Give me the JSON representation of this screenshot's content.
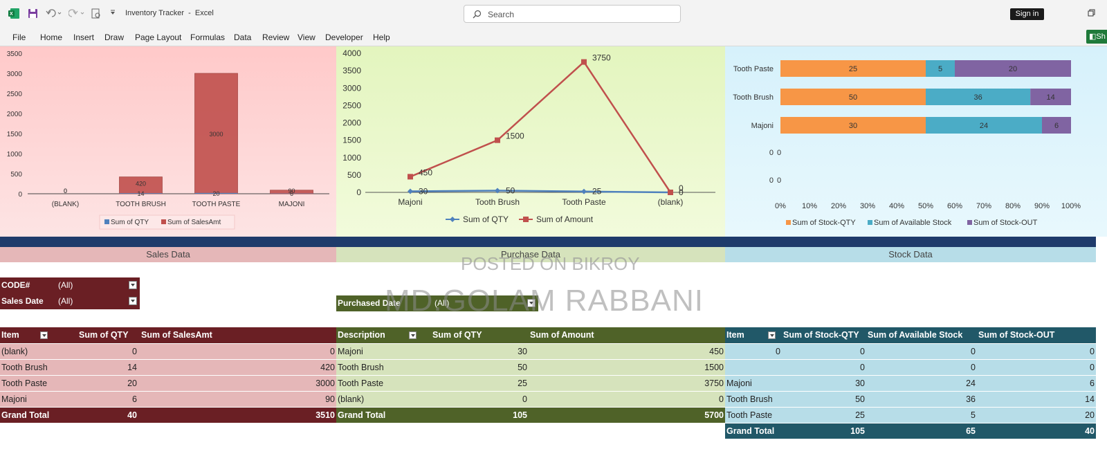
{
  "titlebar": {
    "doc": "Inventory Tracker",
    "sep": "-",
    "app": "Excel",
    "search_label": "Search",
    "signin": "Sign in"
  },
  "menu": [
    "File",
    "Home",
    "Insert",
    "Draw",
    "Page Layout",
    "Formulas",
    "Data",
    "Review",
    "View",
    "Developer",
    "Help"
  ],
  "share_label": "Sh",
  "sections": {
    "sales": "Sales Data",
    "purchase": "Purchase Data",
    "stock": "Stock Data"
  },
  "watermark": {
    "line1": "POSTED ON BIKROY",
    "line2": "MD.GOLAM RABBANI"
  },
  "colors": {
    "sales_dark": "#6a1f24",
    "sales_light": "#e5b7b8",
    "purchase_dark": "#4f6228",
    "purchase_light": "#d6e3bc",
    "stock_dark": "#215868",
    "stock_light": "#b7dde8",
    "bar_red": "#c0504d",
    "line_blue": "#4f81bd",
    "orange": "#f79646",
    "teal": "#4bacc6",
    "purple": "#8064a2"
  },
  "chart_data": [
    {
      "type": "bar",
      "categories": [
        "(BLANK)",
        "TOOTH BRUSH",
        "TOOTH PASTE",
        "MAJONI"
      ],
      "series": [
        {
          "name": "Sum of QTY",
          "values": [
            0,
            14,
            20,
            6
          ]
        },
        {
          "name": "Sum of SalesAmt",
          "values": [
            0,
            420,
            3000,
            90
          ]
        }
      ],
      "ylim": [
        0,
        3500
      ],
      "yticks": [
        "0",
        "500",
        "1000",
        "1500",
        "2000",
        "2500",
        "3000",
        "3500"
      ],
      "legend": "bottom"
    },
    {
      "type": "line",
      "categories": [
        "Majoni",
        "Tooth Brush",
        "Tooth Paste",
        "(blank)"
      ],
      "series": [
        {
          "name": "Sum of QTY",
          "values": [
            30,
            50,
            25,
            0
          ]
        },
        {
          "name": "Sum of Amount",
          "values": [
            450,
            1500,
            3750,
            0
          ]
        }
      ],
      "ylim": [
        0,
        4000
      ],
      "yticks": [
        "0",
        "500",
        "1000",
        "1500",
        "2000",
        "2500",
        "3000",
        "3500",
        "4000"
      ],
      "legend": "bottom"
    },
    {
      "type": "bar",
      "stacked": true,
      "orientation": "horizontal",
      "percent": true,
      "categories": [
        "Tooth Paste",
        "Tooth Brush",
        "Majoni"
      ],
      "series": [
        {
          "name": "Sum of Stock-QTY",
          "values": [
            25,
            50,
            30
          ]
        },
        {
          "name": "Sum of Available Stock",
          "values": [
            5,
            36,
            24
          ]
        },
        {
          "name": "Sum of Stock-OUT",
          "values": [
            20,
            14,
            6
          ]
        }
      ],
      "empty_rows": [
        "0",
        "0"
      ],
      "xticks": [
        "0%",
        "10%",
        "20%",
        "30%",
        "40%",
        "50%",
        "60%",
        "70%",
        "80%",
        "90%",
        "100%"
      ],
      "legend": "bottom"
    }
  ],
  "sales_filters": [
    {
      "label": "CODE#",
      "value": "(All)"
    },
    {
      "label": "Sales Date",
      "value": "(All)"
    }
  ],
  "purchase_filter": {
    "label": "Purchased Date",
    "value": "(All)"
  },
  "sales_table": {
    "headers": [
      "Item",
      "Sum of QTY",
      "Sum of SalesAmt"
    ],
    "rows": [
      [
        "(blank)",
        "0",
        "0"
      ],
      [
        "Tooth Brush",
        "14",
        "420"
      ],
      [
        "Tooth Paste",
        "20",
        "3000"
      ],
      [
        "Majoni",
        "6",
        "90"
      ]
    ],
    "total": [
      "Grand Total",
      "40",
      "3510"
    ]
  },
  "purchase_table": {
    "headers": [
      "Description",
      "Sum of QTY",
      "Sum of Amount"
    ],
    "rows": [
      [
        "Majoni",
        "30",
        "450"
      ],
      [
        "Tooth Brush",
        "50",
        "1500"
      ],
      [
        "Tooth Paste",
        "25",
        "3750"
      ],
      [
        "(blank)",
        "0",
        "0"
      ]
    ],
    "total": [
      "Grand Total",
      "105",
      "5700"
    ]
  },
  "stock_table": {
    "headers": [
      "Item",
      "Sum of Stock-QTY",
      "Sum of Available Stock",
      "Sum of Stock-OUT"
    ],
    "rows": [
      [
        "0",
        "0",
        "0",
        "0"
      ],
      [
        "",
        "0",
        "0",
        "0"
      ],
      [
        "Majoni",
        "30",
        "24",
        "6"
      ],
      [
        "Tooth Brush",
        "50",
        "36",
        "14"
      ],
      [
        "Tooth Paste",
        "25",
        "5",
        "20"
      ]
    ],
    "total": [
      "Grand Total",
      "105",
      "65",
      "40"
    ]
  }
}
